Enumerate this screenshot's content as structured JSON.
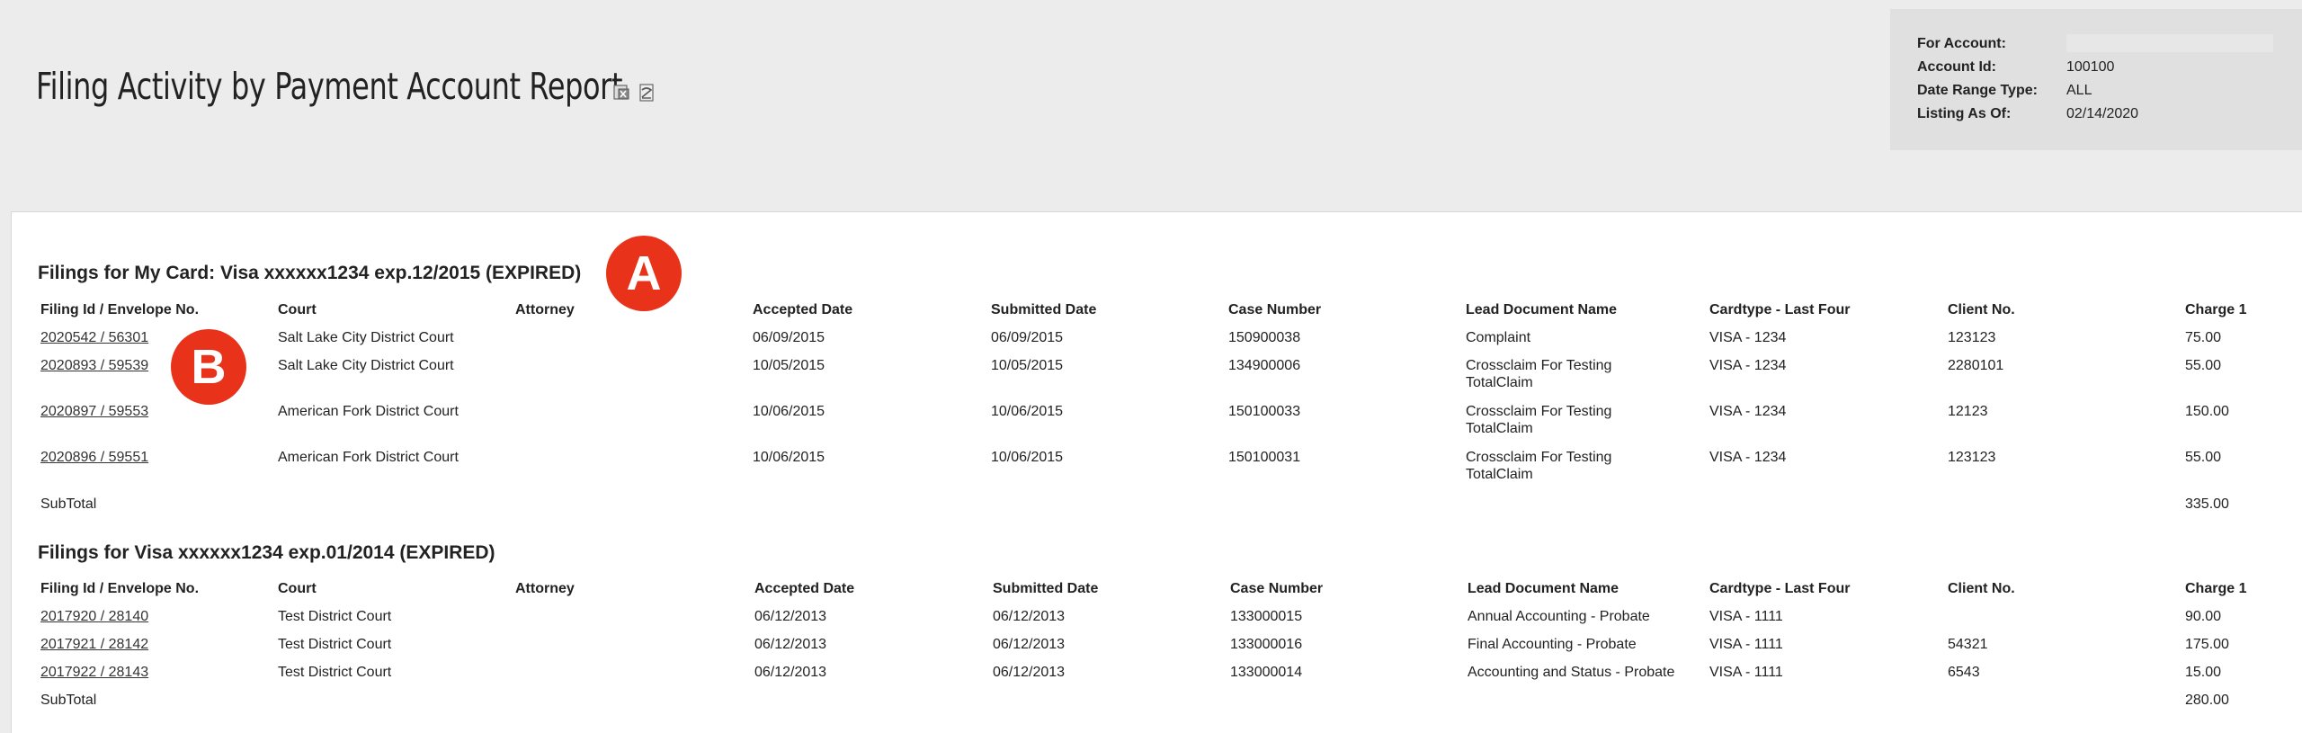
{
  "header": {
    "title": "Filing Activity by Payment Account Report",
    "icons": [
      "export-excel-icon",
      "export-pdf-icon"
    ]
  },
  "account_info": {
    "for_account_label": "For Account:",
    "for_account_value": "",
    "account_id_label": "Account Id:",
    "account_id_value": "100100",
    "date_range_type_label": "Date Range Type:",
    "date_range_type_value": "ALL",
    "listing_as_of_label": "Listing As Of:",
    "listing_as_of_value": "02/14/2020"
  },
  "columns": [
    "Filing Id / Envelope No.",
    "Court",
    "Attorney",
    "Accepted Date",
    "Submitted Date",
    "Case Number",
    "Lead Document Name",
    "Cardtype - Last Four",
    "Client No.",
    "Charge 1"
  ],
  "sections": [
    {
      "title": "Filings for My Card: Visa xxxxxx1234 exp.12/2015 (EXPIRED)",
      "rows": [
        {
          "filing": "2020542 / 56301",
          "court": "Salt Lake City District Court",
          "attorney": "",
          "accepted": "06/09/2015",
          "submitted": "06/09/2015",
          "case": "150900038",
          "doc1": "Complaint",
          "doc2": "",
          "card": "VISA - 1234",
          "client": "123123",
          "charge": "75.00"
        },
        {
          "filing": "2020893 / 59539",
          "court": "Salt Lake City District Court",
          "attorney": "",
          "accepted": "10/05/2015",
          "submitted": "10/05/2015",
          "case": "134900006",
          "doc1": "Crossclaim For Testing",
          "doc2": "TotalClaim",
          "card": "VISA - 1234",
          "client": "2280101",
          "charge": "55.00"
        },
        {
          "filing": "2020897 / 59553",
          "court": "American Fork District Court",
          "attorney": "",
          "accepted": "10/06/2015",
          "submitted": "10/06/2015",
          "case": "150100033",
          "doc1": "Crossclaim For Testing",
          "doc2": "TotalClaim",
          "card": "VISA - 1234",
          "client": "12123",
          "charge": "150.00"
        },
        {
          "filing": "2020896 / 59551",
          "court": "American Fork District Court",
          "attorney": "",
          "accepted": "10/06/2015",
          "submitted": "10/06/2015",
          "case": "150100031",
          "doc1": "Crossclaim For Testing",
          "doc2": "TotalClaim",
          "card": "VISA - 1234",
          "client": "123123",
          "charge": "55.00"
        }
      ],
      "subtotal_label": "SubTotal",
      "subtotal_value": "335.00"
    },
    {
      "title": "Filings for Visa xxxxxx1234 exp.01/2014 (EXPIRED)",
      "rows": [
        {
          "filing": "2017920 / 28140",
          "court": "Test District Court",
          "attorney": "",
          "accepted": "06/12/2013",
          "submitted": "06/12/2013",
          "case": "133000015",
          "doc1": "Annual Accounting - Probate",
          "doc2": "",
          "card": "VISA - 1111",
          "client": "",
          "charge": "90.00"
        },
        {
          "filing": "2017921 / 28142",
          "court": "Test District Court",
          "attorney": "",
          "accepted": "06/12/2013",
          "submitted": "06/12/2013",
          "case": "133000016",
          "doc1": "Final Accounting - Probate",
          "doc2": "",
          "card": "VISA - 1111",
          "client": "54321",
          "charge": "175.00"
        },
        {
          "filing": "2017922 / 28143",
          "court": "Test District Court",
          "attorney": "",
          "accepted": "06/12/2013",
          "submitted": "06/12/2013",
          "case": "133000014",
          "doc1": "Accounting and Status - Probate",
          "doc2": "",
          "card": "VISA - 1111",
          "client": "6543",
          "charge": "15.00"
        }
      ],
      "subtotal_label": "SubTotal",
      "subtotal_value": "280.00"
    }
  ],
  "annotations": {
    "a_label": "A",
    "b_label": "B",
    "color": "#e8321a"
  }
}
